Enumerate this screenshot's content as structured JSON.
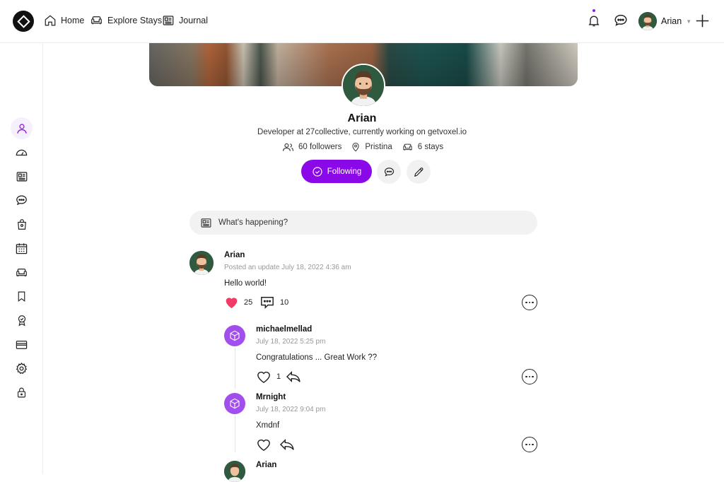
{
  "nav": {
    "home": "Home",
    "explore": "Explore Stays",
    "journal": "Journal",
    "user_name": "Arian",
    "accent": "#8b09e8"
  },
  "profile": {
    "name": "Arian",
    "bio": "Developer at 27collective, currently working on getvoxel.io",
    "followers": "60 followers",
    "location": "Pristina",
    "stays": "6 stays",
    "follow_label": "Following"
  },
  "composer": {
    "placeholder": "What's happening?"
  },
  "post": {
    "author": "Arian",
    "meta": "Posted an update July 18, 2022 4:36 am",
    "text": "Hello world!",
    "likes": "25",
    "comments": "10"
  },
  "replies": [
    {
      "author": "michaelmellad",
      "date": "July 18, 2022 5:25 pm",
      "text": "Congratulations ... Great Work ??",
      "likes": "1"
    },
    {
      "author": "Mrnight",
      "date": "July 18, 2022 9:04 pm",
      "text": "Xmdnf",
      "likes": ""
    },
    {
      "author": "Arian"
    }
  ]
}
